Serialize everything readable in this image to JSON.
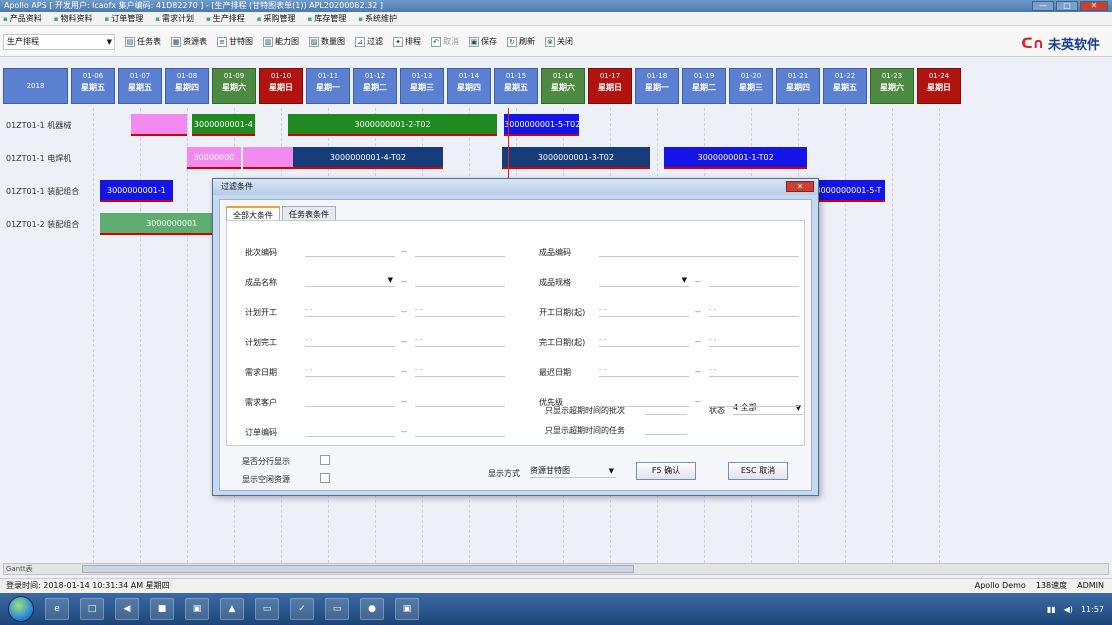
{
  "window": {
    "title": "Apollo APS [ 开发用户: lcaofx 集户编码: 41D82270 ] - [生产排程 (甘特图表单(1)) APL20200082.32 ]",
    "controls": [
      "—",
      "□",
      "✕"
    ]
  },
  "menu": [
    "产品资料",
    "物料资料",
    "订单管理",
    "需求计划",
    "生产排程",
    "采购管理",
    "库存管理",
    "系统维护"
  ],
  "toolbar": {
    "module_select": "生产排程",
    "buttons": [
      {
        "label": "任务表",
        "icon": "task-table-icon",
        "glyph": "▤",
        "enabled": true
      },
      {
        "label": "资源表",
        "icon": "resource-table-icon",
        "glyph": "▦",
        "enabled": true
      },
      {
        "label": "甘特图",
        "icon": "gantt-icon",
        "glyph": "≡",
        "enabled": true
      },
      {
        "label": "能力图",
        "icon": "capacity-chart-icon",
        "glyph": "▥",
        "enabled": true
      },
      {
        "label": "数量图",
        "icon": "quantity-chart-icon",
        "glyph": "▨",
        "enabled": true
      },
      {
        "label": "过滤",
        "icon": "filter-icon",
        "glyph": "⊿",
        "enabled": true
      },
      {
        "label": "排程",
        "icon": "schedule-icon",
        "glyph": "✦",
        "enabled": true
      },
      {
        "label": "取消",
        "icon": "undo-icon",
        "glyph": "↶",
        "enabled": false
      },
      {
        "label": "保存",
        "icon": "save-icon",
        "glyph": "▣",
        "enabled": true
      },
      {
        "label": "刷新",
        "icon": "refresh-icon",
        "glyph": "↻",
        "enabled": true
      },
      {
        "label": "关闭",
        "icon": "close-icon",
        "glyph": "⊗",
        "enabled": true
      }
    ],
    "logo_text": "未英软件"
  },
  "gantt": {
    "year_label": "2018",
    "days": [
      {
        "date": "01-06",
        "weekday": "星期五",
        "type": "normal"
      },
      {
        "date": "01-07",
        "weekday": "星期五",
        "type": "normal"
      },
      {
        "date": "01-08",
        "weekday": "星期四",
        "type": "normal"
      },
      {
        "date": "01-09",
        "weekday": "星期六",
        "type": "sat"
      },
      {
        "date": "01-10",
        "weekday": "星期日",
        "type": "sun"
      },
      {
        "date": "01-11",
        "weekday": "星期一",
        "type": "normal"
      },
      {
        "date": "01-12",
        "weekday": "星期二",
        "type": "normal"
      },
      {
        "date": "01-13",
        "weekday": "星期三",
        "type": "normal"
      },
      {
        "date": "01-14",
        "weekday": "星期四",
        "type": "normal"
      },
      {
        "date": "01-15",
        "weekday": "星期五",
        "type": "normal"
      },
      {
        "date": "01-16",
        "weekday": "星期六",
        "type": "sat"
      },
      {
        "date": "01-17",
        "weekday": "星期日",
        "type": "sun"
      },
      {
        "date": "01-18",
        "weekday": "星期一",
        "type": "normal"
      },
      {
        "date": "01-19",
        "weekday": "星期二",
        "type": "normal"
      },
      {
        "date": "01-20",
        "weekday": "星期三",
        "type": "normal"
      },
      {
        "date": "01-21",
        "weekday": "星期四",
        "type": "normal"
      },
      {
        "date": "01-22",
        "weekday": "星期五",
        "type": "normal"
      },
      {
        "date": "01-23",
        "weekday": "星期六",
        "type": "sat"
      },
      {
        "date": "01-24",
        "weekday": "星期日",
        "type": "sun"
      }
    ],
    "rows": [
      {
        "label": "01ZT01-1 机器械",
        "bars": [
          {
            "text": "",
            "color": "pink",
            "start": 0.65,
            "end": 1.85
          },
          {
            "text": "3000000001-4",
            "color": "green",
            "start": 1.95,
            "end": 3.3
          },
          {
            "text": "3000000001-2-T02",
            "color": "green",
            "start": 4.0,
            "end": 8.45
          },
          {
            "text": "3000000001-5-T02",
            "color": "blue",
            "start": 8.6,
            "end": 10.2
          }
        ]
      },
      {
        "label": "01ZT01-1 电焊机",
        "bars": [
          {
            "text": "30000000",
            "color": "pink",
            "start": 1.85,
            "end": 3.0
          },
          {
            "text": "",
            "color": "pink",
            "start": 3.05,
            "end": 4.1
          },
          {
            "text": "3000000001-4-T02",
            "color": "navy",
            "start": 4.1,
            "end": 7.3
          },
          {
            "text": "3000000001-3-T02",
            "color": "navy",
            "start": 8.55,
            "end": 11.7
          },
          {
            "text": "3000000001-1-T02",
            "color": "blue",
            "start": 12.0,
            "end": 15.05
          }
        ]
      },
      {
        "label": "01ZT01-1 装配组合",
        "bars": [
          {
            "text": "3000000001-1",
            "color": "blue",
            "start": 0.0,
            "end": 1.55
          },
          {
            "text": "3000000001-5-T",
            "color": "blue",
            "start": 15.15,
            "end": 16.7
          }
        ]
      },
      {
        "label": "01ZT01-2 装配组合",
        "bars": [
          {
            "text": "3000000001",
            "color": "lightgreen",
            "start": 0.0,
            "end": 3.05
          }
        ]
      }
    ]
  },
  "dialog": {
    "title": "过滤条件",
    "close": "✕",
    "tabs": [
      "全部大条件",
      "任务表条件"
    ],
    "fields_left": [
      {
        "label": "批次编码",
        "kind": "text"
      },
      {
        "label": "成品名称",
        "kind": "select"
      },
      {
        "label": "计划开工",
        "kind": "date"
      },
      {
        "label": "计划完工",
        "kind": "date"
      },
      {
        "label": "需求日期",
        "kind": "date"
      },
      {
        "label": "需求客户",
        "kind": "text"
      },
      {
        "label": "订单编码",
        "kind": "text"
      }
    ],
    "fields_right": [
      {
        "label": "成品编码",
        "kind": "plain"
      },
      {
        "label": "成品规格",
        "kind": "select"
      },
      {
        "label": "开工日期(起)",
        "kind": "date"
      },
      {
        "label": "完工日期(起)",
        "kind": "date"
      },
      {
        "label": "最迟日期",
        "kind": "date"
      },
      {
        "label": "优先级",
        "kind": "text"
      }
    ],
    "date_placeholder": "- -",
    "range_dash": "--",
    "option_show_over_batch": "只显示超期时间的批次",
    "option_show_over_task": "只显示超期时间的任务",
    "status_label": "状态",
    "status_value": "4 全部",
    "chk_split_rows": "是否分行显示",
    "chk_show_idle": "显示空闲资源",
    "display_mode_label": "显示方式",
    "display_mode_value": "资源甘特图",
    "ok_button": "F5 确认",
    "cancel_button": "ESC 取消"
  },
  "statusbar": {
    "login_time": "登录时间: 2018-01-14 10:31:34 AM 星期四",
    "right_items": [
      "Apollo Demo",
      "138速度",
      "ADMIN"
    ],
    "sheet_tab": "Gantt表"
  },
  "taskbar": {
    "apps": [
      "e",
      "□",
      "◀",
      "■",
      "▣",
      "▲",
      "▭",
      "✓",
      "▭",
      "●",
      "▣"
    ],
    "clock": "11:57"
  }
}
